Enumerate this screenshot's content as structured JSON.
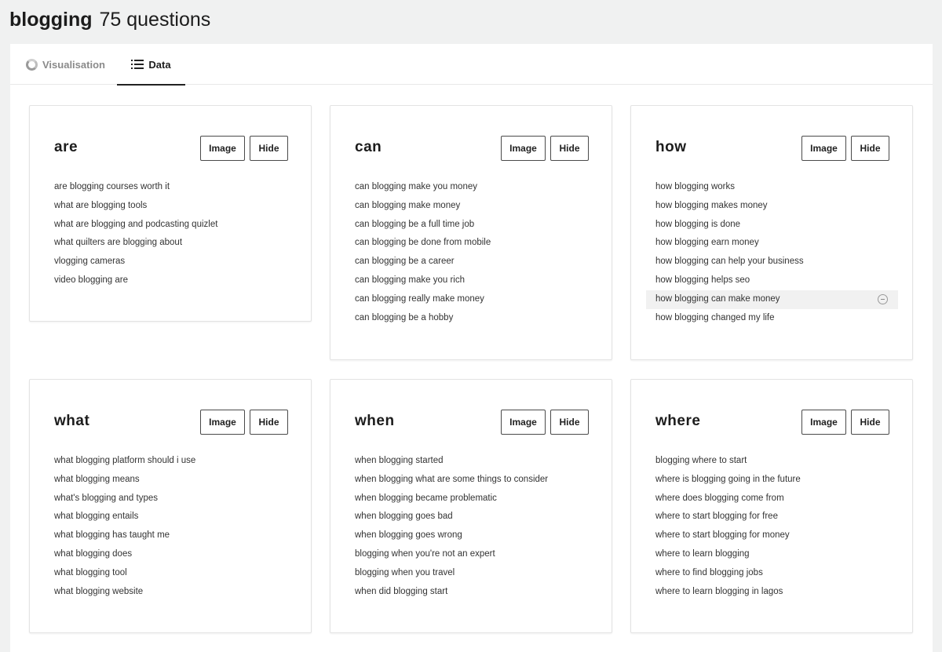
{
  "header": {
    "keyword": "blogging",
    "count": "75 questions"
  },
  "tabs": {
    "visualisation": "Visualisation",
    "data": "Data"
  },
  "buttons": {
    "image": "Image",
    "hide": "Hide"
  },
  "cards": [
    {
      "title": "are",
      "items": [
        "are blogging courses worth it",
        "what are blogging tools",
        "what are blogging and podcasting quizlet",
        "what quilters are blogging about",
        "vlogging cameras",
        "video blogging are"
      ]
    },
    {
      "title": "can",
      "items": [
        "can blogging make you money",
        "can blogging make money",
        "can blogging be a full time job",
        "can blogging be done from mobile",
        "can blogging be a career",
        "can blogging make you rich",
        "can blogging really make money",
        "can blogging be a hobby"
      ]
    },
    {
      "title": "how",
      "items": [
        "how blogging works",
        "how blogging makes money",
        "how blogging is done",
        "how blogging earn money",
        "how blogging can help your business",
        "how blogging helps seo",
        "how blogging can make money",
        "how blogging changed my life"
      ]
    },
    {
      "title": "what",
      "items": [
        "what blogging platform should i use",
        "what blogging means",
        "what's blogging and types",
        "what blogging entails",
        "what blogging has taught me",
        "what blogging does",
        "what blogging tool",
        "what blogging website"
      ]
    },
    {
      "title": "when",
      "items": [
        "when blogging started",
        "when blogging what are some things to consider",
        "when blogging became problematic",
        "when blogging goes bad",
        "when blogging goes wrong",
        "blogging when you're not an expert",
        "blogging when you travel",
        "when did blogging start"
      ]
    },
    {
      "title": "where",
      "items": [
        "blogging where to start",
        "where is blogging going in the future",
        "where does blogging come from",
        "where to start blogging for free",
        "where to start blogging for money",
        "where to learn blogging",
        "where to find blogging jobs",
        "where to learn blogging in lagos"
      ]
    }
  ]
}
